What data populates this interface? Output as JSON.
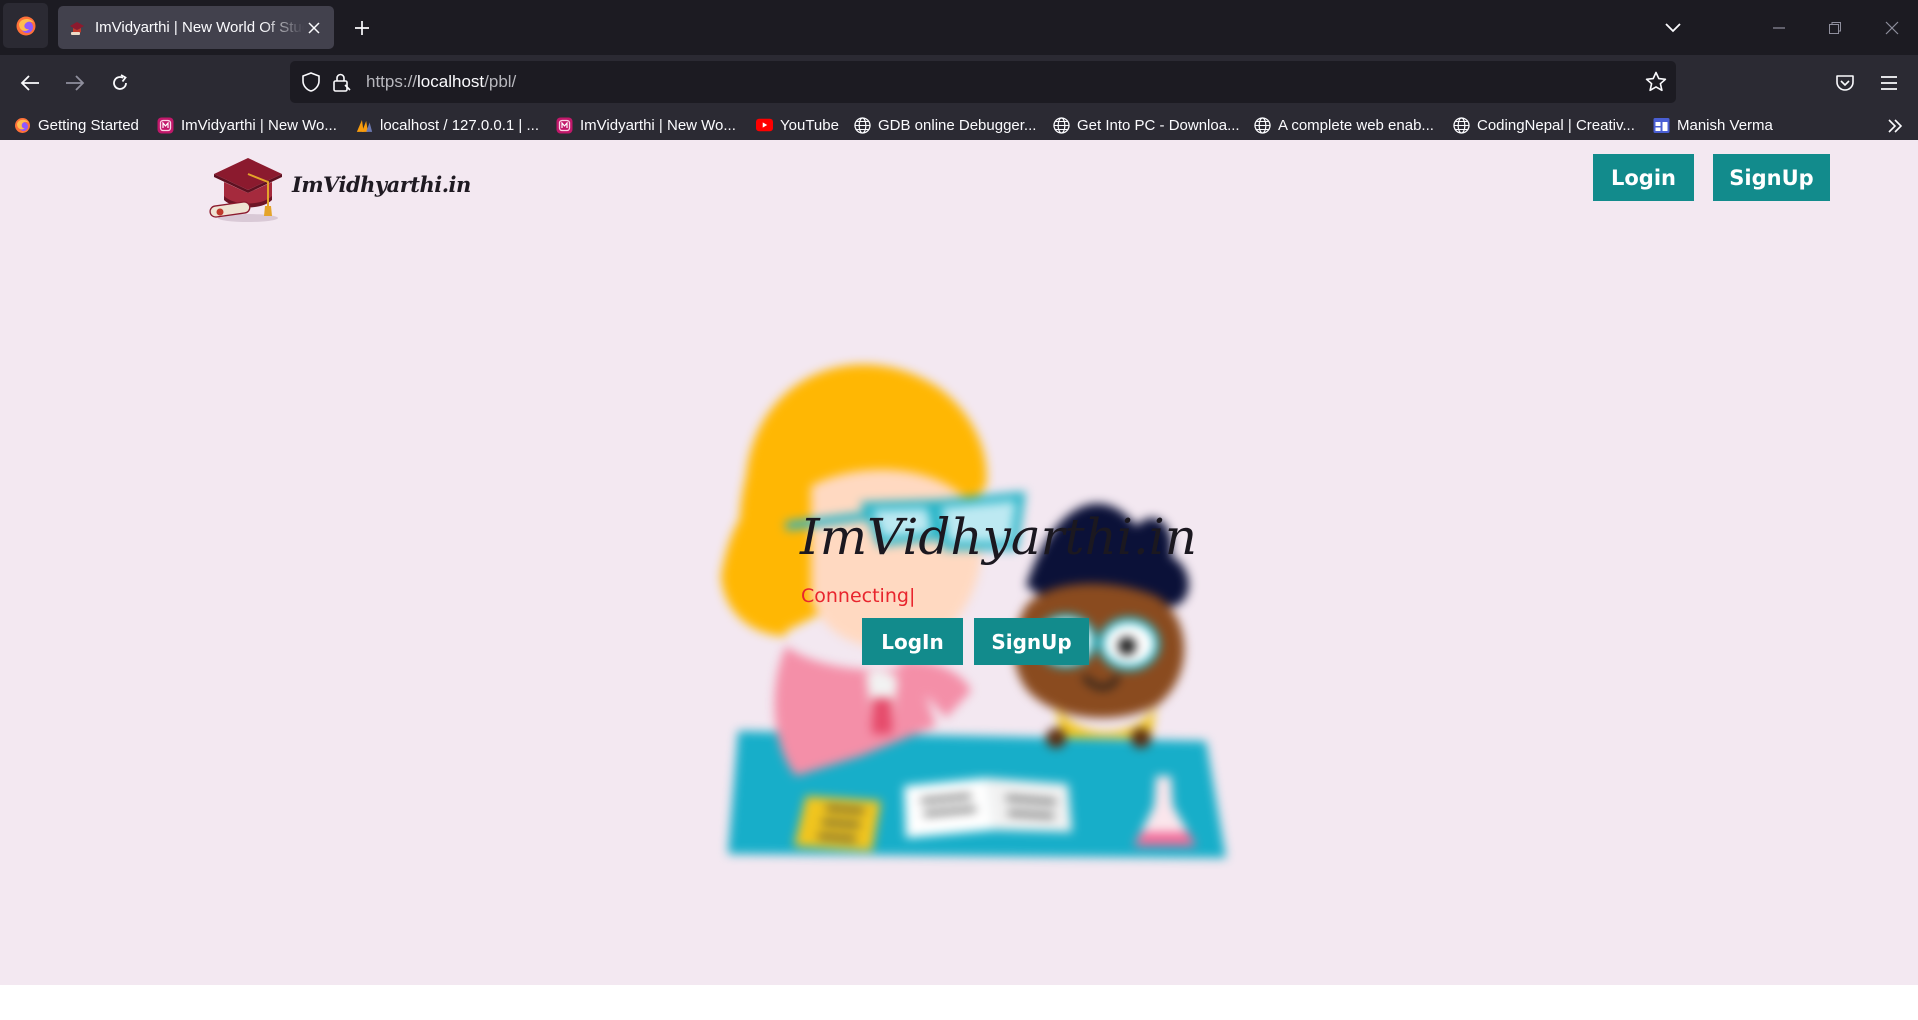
{
  "browser": {
    "tab": {
      "title": "ImVidyarthi | New World Of Students"
    },
    "url": {
      "scheme": "https://",
      "host": "localhost",
      "path": "/pbl/"
    },
    "bookmarks": [
      {
        "label": "Getting Started",
        "icon": "firefox-icon"
      },
      {
        "label": "ImVidyarthi | New Wo...",
        "icon": "imvidyarthi-favicon"
      },
      {
        "label": "localhost / 127.0.0.1 | ...",
        "icon": "phpmyadmin-icon"
      },
      {
        "label": "ImVidyarthi | New Wo...",
        "icon": "imvidyarthi-favicon"
      },
      {
        "label": "YouTube",
        "icon": "youtube-icon"
      },
      {
        "label": "GDB online Debugger...",
        "icon": "globe-icon"
      },
      {
        "label": "Get Into PC - Downloa...",
        "icon": "globe-icon"
      },
      {
        "label": "A complete web enab...",
        "icon": "globe-icon"
      },
      {
        "label": "CodingNepal | Creativ...",
        "icon": "globe-icon"
      },
      {
        "label": "Manish Verma",
        "icon": "calendar-icon"
      }
    ]
  },
  "site": {
    "brand": "ImVidhyarthi.in",
    "header": {
      "login_label": "Login",
      "signup_label": "SignUp"
    },
    "hero": {
      "title": "ImVidhyarthi.in",
      "status": "Connecting|",
      "login_label": "LogIn",
      "signup_label": "SignUp"
    }
  },
  "colors": {
    "page_bg": "#f3e8f1",
    "accent": "#128b8c",
    "status_text": "#e8252d",
    "chrome_dark": "#1c1b22",
    "chrome": "#2b2a33"
  }
}
